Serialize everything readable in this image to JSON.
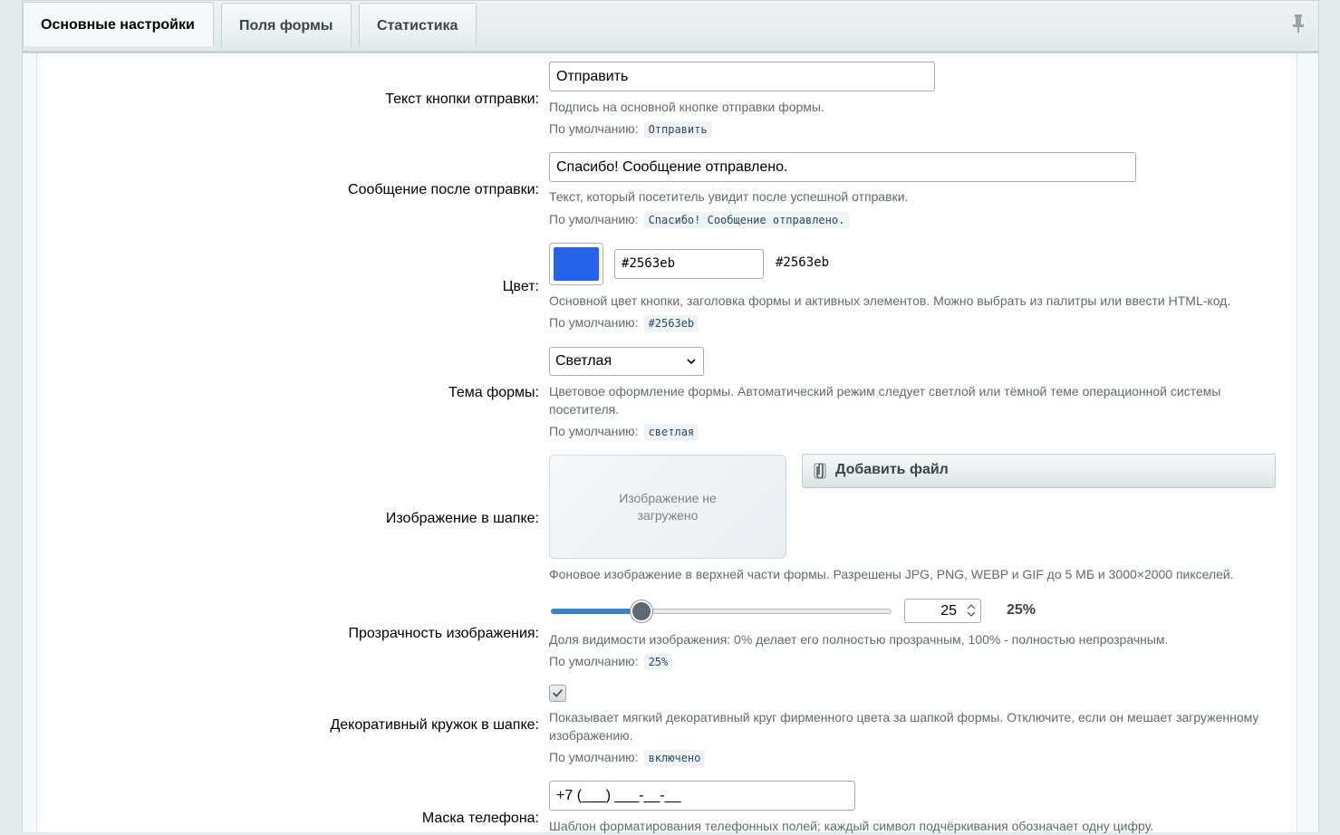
{
  "tabs": [
    {
      "label": "Основные настройки",
      "active": true
    },
    {
      "label": "Поля формы",
      "active": false
    },
    {
      "label": "Статистика",
      "active": false
    }
  ],
  "default_prefix": "По умолчанию:",
  "fields": {
    "submit_text": {
      "label": "Текст кнопки отправки:",
      "value": "Отправить",
      "hint": "Подпись на основной кнопке отправки формы.",
      "default": "Отправить"
    },
    "success_message": {
      "label": "Сообщение после отправки:",
      "value": "Спасибо! Сообщение отправлено.",
      "hint": "Текст, который посетитель увидит после успешной отправки.",
      "default": "Спасибо! Сообщение отправлено."
    },
    "color": {
      "label": "Цвет:",
      "value": "#2563eb",
      "display": "#2563eb",
      "hint": "Основной цвет кнопки, заголовка формы и активных элементов. Можно выбрать из палитры или ввести HTML-код.",
      "default": "#2563eb"
    },
    "theme": {
      "label": "Тема формы:",
      "value": "Светлая",
      "hint": "Цветовое оформление формы. Автоматический режим следует светлой или тёмной теме операционной системы посетителя.",
      "default": "светлая"
    },
    "header_image": {
      "label": "Изображение в шапке:",
      "placeholder": "Изображение не загружено",
      "add_button": "Добавить файл",
      "hint": "Фоновое изображение в верхней части формы. Разрешены JPG, PNG, WEBP и GIF до 5 МБ и 3000×2000 пикселей."
    },
    "image_opacity": {
      "label": "Прозрачность изображения:",
      "value": 25,
      "value_text": "25",
      "percent": "25%",
      "hint": "Доля видимости изображения: 0% делает его полностью прозрачным, 100% - полностью непрозрачным.",
      "default": "25%"
    },
    "decor_circle": {
      "label": "Декоративный кружок в шапке:",
      "checked": true,
      "hint": "Показывает мягкий декоративный круг фирменного цвета за шапкой формы. Отключите, если он мешает загруженному изображению.",
      "default": "включено"
    },
    "phone_mask": {
      "label": "Маска телефона:",
      "value": "+7 (___) ___-__-__",
      "hint": "Шаблон форматирования телефонных полей; каждый символ подчёркивания обозначает одну цифру."
    }
  },
  "icons": {
    "pin": "pin-icon",
    "clip": "paperclip-icon",
    "chevron": "chevron-down-icon",
    "check": "check-icon"
  },
  "colors": {
    "accent": "#2563eb",
    "slider_fill": "#3b82c4"
  }
}
